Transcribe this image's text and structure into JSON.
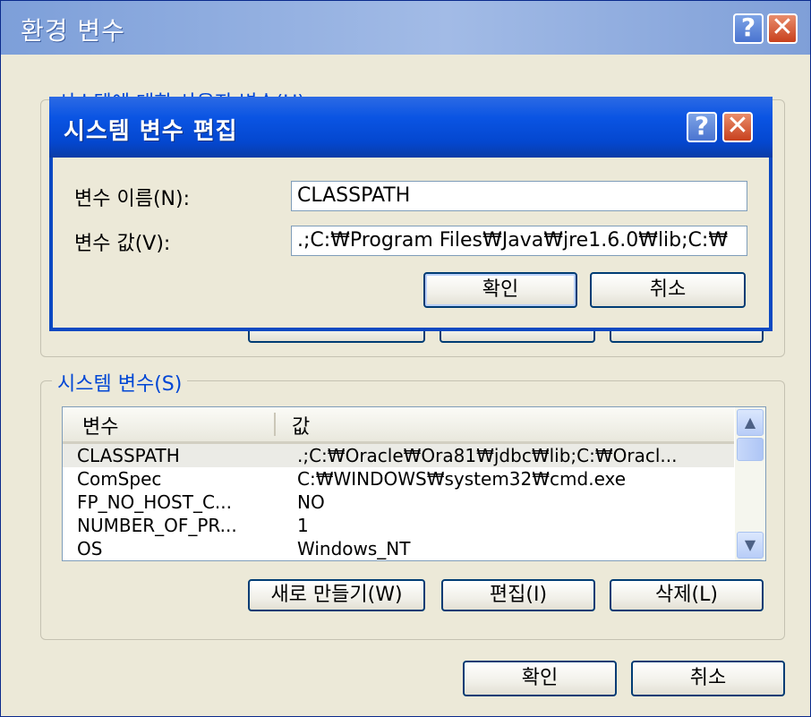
{
  "window": {
    "title": "환경 변수",
    "help_glyph": "?",
    "close_glyph": "✕"
  },
  "user_vars_group": {
    "legend": "시스템에 대한 사용자 변수(U)"
  },
  "system_vars_group": {
    "legend": "시스템 변수(S)",
    "columns": [
      "변수",
      "값"
    ],
    "rows": [
      {
        "name": "CLASSPATH",
        "value": ".;C:₩Oracle₩Ora81₩jdbc₩lib;C:₩Oracl..."
      },
      {
        "name": "ComSpec",
        "value": "C:₩WINDOWS₩system32₩cmd.exe"
      },
      {
        "name": "FP_NO_HOST_C...",
        "value": "NO"
      },
      {
        "name": "NUMBER_OF_PR...",
        "value": "1"
      },
      {
        "name": "OS",
        "value": "Windows_NT"
      }
    ],
    "new_button": "새로 만들기(W)",
    "edit_button": "편집(I)",
    "delete_button": "삭제(L)"
  },
  "footer": {
    "ok_button": "확인",
    "cancel_button": "취소"
  },
  "edit_dialog": {
    "title": "시스템 변수 편집",
    "name_label": "변수 이름(N):",
    "name_value": "CLASSPATH",
    "value_label": "변수 값(V):",
    "value_value": ".;C:₩Program Files₩Java₩jre1.6.0₩lib;C:₩",
    "ok_button": "확인",
    "cancel_button": "취소"
  },
  "colors": {
    "title_blue": "#0a54e3",
    "dialog_face": "#ece9d8",
    "group_text": "#0046d5",
    "close_red": "#c8401d"
  }
}
